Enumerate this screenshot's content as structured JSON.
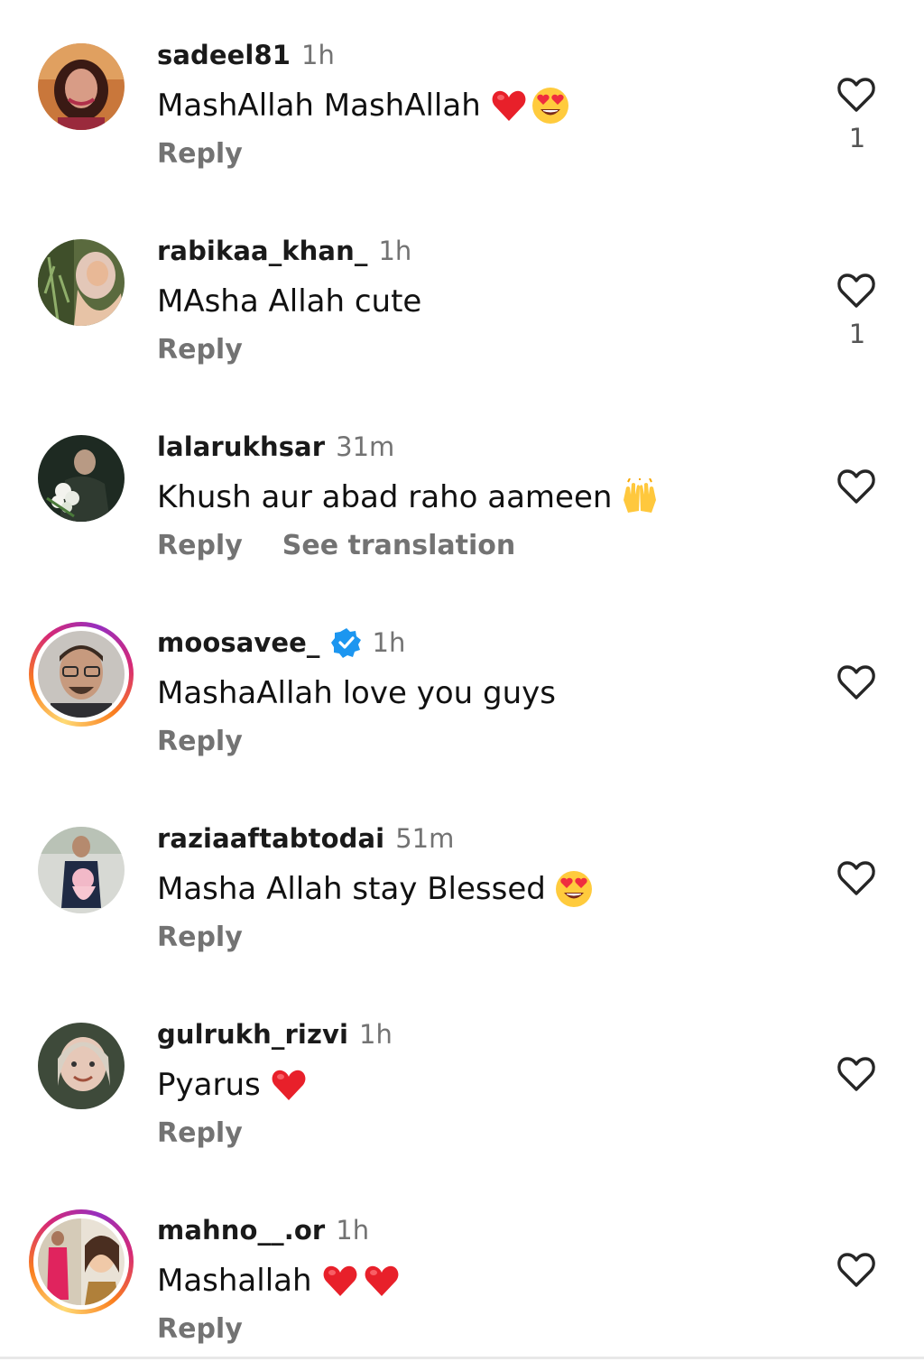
{
  "reply_label": "Reply",
  "see_translation_label": "See translation",
  "comments": [
    {
      "username": "sadeel81",
      "time": "1h",
      "text": "MashAllah MashAllah",
      "emojis": [
        "red-heart",
        "heart-eyes"
      ],
      "likes": "1",
      "verified": false,
      "story_ring": false
    },
    {
      "username": "rabikaa_khan_",
      "time": "1h",
      "text": "MAsha Allah cute",
      "emojis": [],
      "likes": "1",
      "verified": false,
      "story_ring": false
    },
    {
      "username": "lalarukhsar",
      "time": "31m",
      "text": "Khush aur abad raho aameen",
      "emojis": [
        "raising-hands"
      ],
      "likes": "",
      "verified": false,
      "story_ring": false,
      "show_translation": true
    },
    {
      "username": "moosavee_",
      "time": "1h",
      "text": "MashaAllah love you guys",
      "emojis": [],
      "likes": "",
      "verified": true,
      "story_ring": true
    },
    {
      "username": "raziaaftabtodai",
      "time": "51m",
      "text": "Masha Allah stay Blessed",
      "emojis": [
        "heart-eyes"
      ],
      "likes": "",
      "verified": false,
      "story_ring": false
    },
    {
      "username": "gulrukh_rizvi",
      "time": "1h",
      "text": "Pyarus",
      "emojis": [
        "red-heart"
      ],
      "likes": "",
      "verified": false,
      "story_ring": false
    },
    {
      "username": "mahno__.or",
      "time": "1h",
      "text": "Mashallah",
      "emojis": [
        "red-heart",
        "red-heart"
      ],
      "likes": "",
      "verified": false,
      "story_ring": true
    }
  ],
  "colors": {
    "text": "#111111",
    "muted": "#737373",
    "verified_blue": "#1c96f0",
    "heart_red": "#e8202a"
  }
}
